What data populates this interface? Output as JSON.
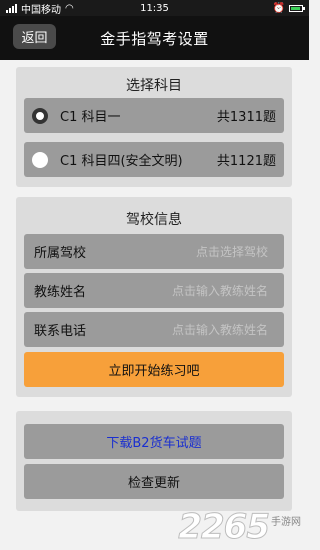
{
  "status_bar": {
    "carrier": "中国移动",
    "time": "11:35",
    "battery_level": 0.9,
    "icons": [
      "signal-icon",
      "wifi-icon",
      "alarm-icon",
      "battery-icon"
    ]
  },
  "header": {
    "back_label": "返回",
    "title": "金手指驾考设置"
  },
  "subject_section": {
    "title": "选择科目",
    "options": [
      {
        "label": "C1 科目一",
        "count": "共1311题",
        "selected": true
      },
      {
        "label": "C1 科目四(安全文明)",
        "count": "共1121题",
        "selected": false
      }
    ]
  },
  "school_section": {
    "title": "驾校信息",
    "fields": [
      {
        "label": "所属驾校",
        "placeholder": "点击选择驾校",
        "value": ""
      },
      {
        "label": "教练姓名",
        "placeholder": "点击输入教练姓名",
        "value": ""
      },
      {
        "label": "联系电话",
        "placeholder": "点击输入教练姓名",
        "value": ""
      }
    ],
    "start_button": "立即开始练习吧"
  },
  "bottom_section": {
    "download_label": "下载B2货车试题",
    "update_label": "检查更新"
  },
  "watermark": {
    "number": "2265",
    "sub": "手游网"
  },
  "colors": {
    "accent_orange": "#f7a03a",
    "link_blue": "#1a2fd0",
    "row_gray": "#9b9b9b",
    "panel_gray": "#dcdcdc"
  }
}
